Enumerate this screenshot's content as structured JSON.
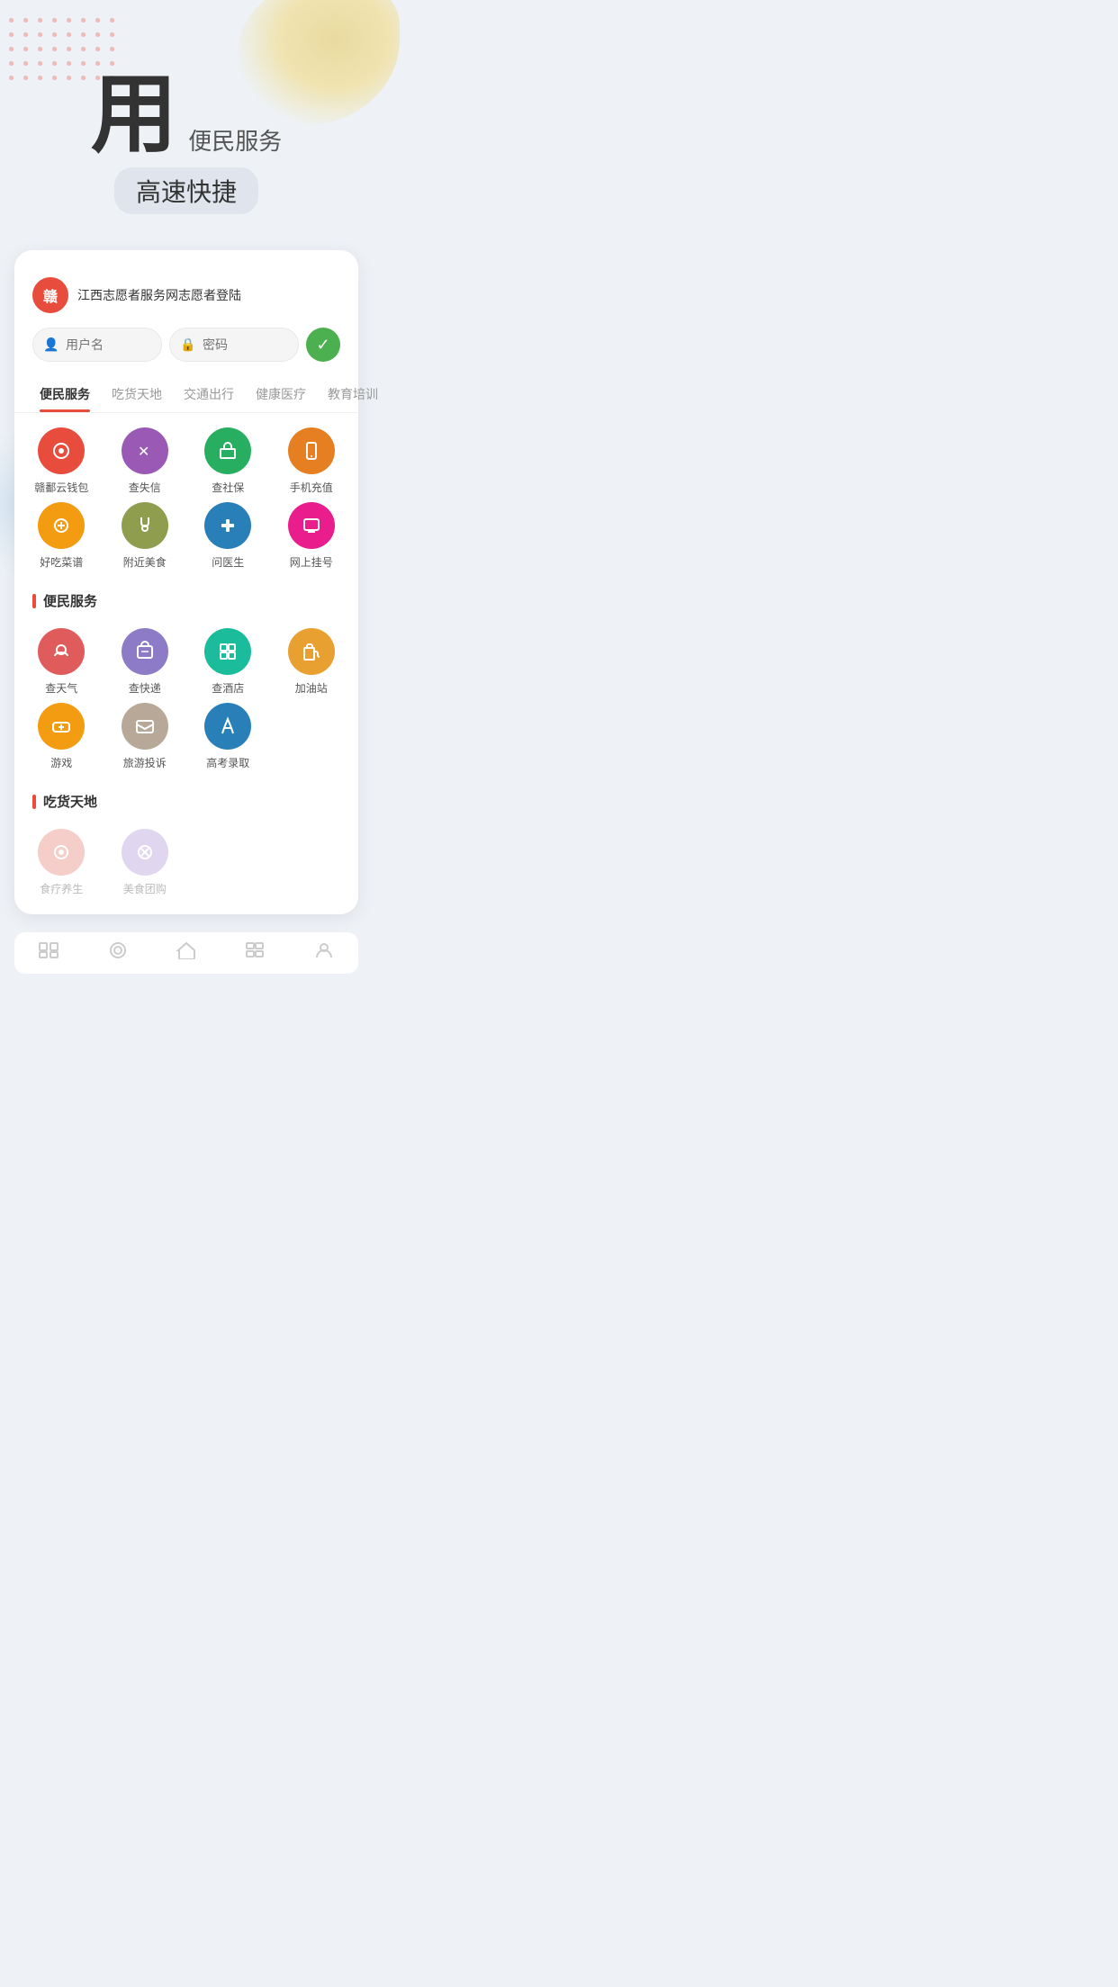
{
  "hero": {
    "main_char": "用",
    "subtitle_1": "便民服务",
    "subtitle_2": "高速快捷"
  },
  "login": {
    "logo_text": "赣",
    "title": "江西志愿者服务网志愿者登陆",
    "username_placeholder": "用户名",
    "password_placeholder": "密码",
    "confirm_icon": "✓"
  },
  "tabs": [
    {
      "label": "便民服务",
      "active": true
    },
    {
      "label": "吃货天地",
      "active": false
    },
    {
      "label": "交通出行",
      "active": false
    },
    {
      "label": "健康医疗",
      "active": false
    },
    {
      "label": "教育培训",
      "active": false
    }
  ],
  "quick_icons": [
    {
      "label": "赣鄱云钱包",
      "icon": "◎",
      "color": "c-red"
    },
    {
      "label": "查失信",
      "icon": "✕",
      "color": "c-purple"
    },
    {
      "label": "查社保",
      "icon": "⌂",
      "color": "c-green"
    },
    {
      "label": "手机充值",
      "icon": "📱",
      "color": "c-orange"
    },
    {
      "label": "好吃菜谱",
      "icon": "🍱",
      "color": "c-yellow"
    },
    {
      "label": "附近美食",
      "icon": "🍸",
      "color": "c-olive"
    },
    {
      "label": "问医生",
      "icon": "✚",
      "color": "c-blue"
    },
    {
      "label": "网上挂号",
      "icon": "🖥",
      "color": "c-pink"
    }
  ],
  "section1": {
    "title": "便民服务"
  },
  "service_icons": [
    {
      "label": "查天气",
      "icon": "☁",
      "color": "c-coral"
    },
    {
      "label": "查快递",
      "icon": "⬡",
      "color": "c-lavender"
    },
    {
      "label": "查酒店",
      "icon": "⊞",
      "color": "c-teal"
    },
    {
      "label": "加油站",
      "icon": "⛽",
      "color": "c-amber"
    },
    {
      "label": "游戏",
      "icon": "🎮",
      "color": "c-yellow"
    },
    {
      "label": "旅游投诉",
      "icon": "✉",
      "color": "c-tan"
    },
    {
      "label": "高考录取",
      "icon": "✏",
      "color": "c-blue"
    }
  ],
  "section2": {
    "title": "吃货天地"
  },
  "food_icons": [
    {
      "label": "食疗养生",
      "icon": "◎",
      "color": "c-light-red",
      "dimmed": true
    },
    {
      "label": "美食团购",
      "icon": "✕",
      "color": "c-light-purple",
      "dimmed": true
    }
  ],
  "bottom_nav": [
    {
      "icon": "⊟",
      "label": ""
    },
    {
      "icon": "◎",
      "label": ""
    },
    {
      "icon": "⌂",
      "label": ""
    },
    {
      "icon": "⊞",
      "label": ""
    },
    {
      "icon": "◉",
      "label": ""
    }
  ]
}
